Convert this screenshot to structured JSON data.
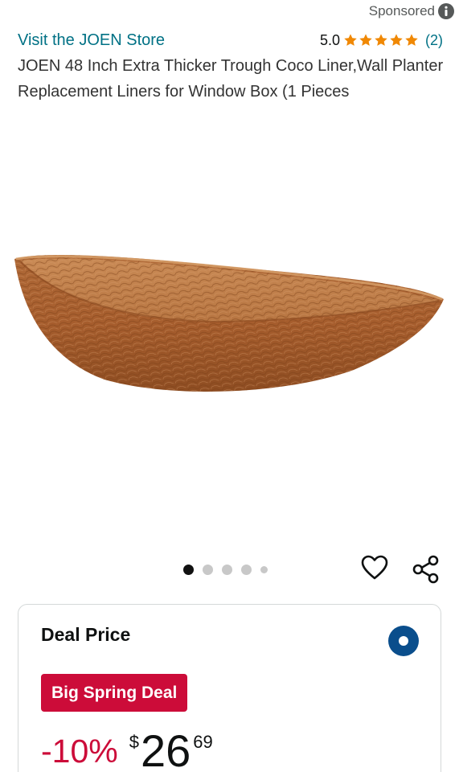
{
  "sponsored": {
    "label": "Sponsored",
    "icon": "info-icon"
  },
  "store": {
    "link_text": "Visit the JOEN Store"
  },
  "rating": {
    "value": "5.0",
    "stars": 5,
    "star_color": "#f08804",
    "count": "(2)"
  },
  "product": {
    "title": "JOEN 48 Inch Extra Thicker Trough Coco Liner,Wall Planter Replacement Liners for Window Box (1 Pieces",
    "image_icon": "coco-liner-product-image"
  },
  "carousel": {
    "total_dots": 5,
    "active_index": 0
  },
  "actions": {
    "wishlist_icon": "heart-icon",
    "share_icon": "share-icon"
  },
  "deal": {
    "title": "Deal Price",
    "badge": "Big Spring Deal",
    "badge_color": "#cc0c39",
    "discount": "-10%",
    "currency_symbol": "$",
    "price_whole": "26",
    "price_fraction": "69",
    "radio_selected": true,
    "radio_color": "#0a4e8c"
  },
  "colors": {
    "link": "#007185",
    "deal_red": "#cc0c39"
  }
}
